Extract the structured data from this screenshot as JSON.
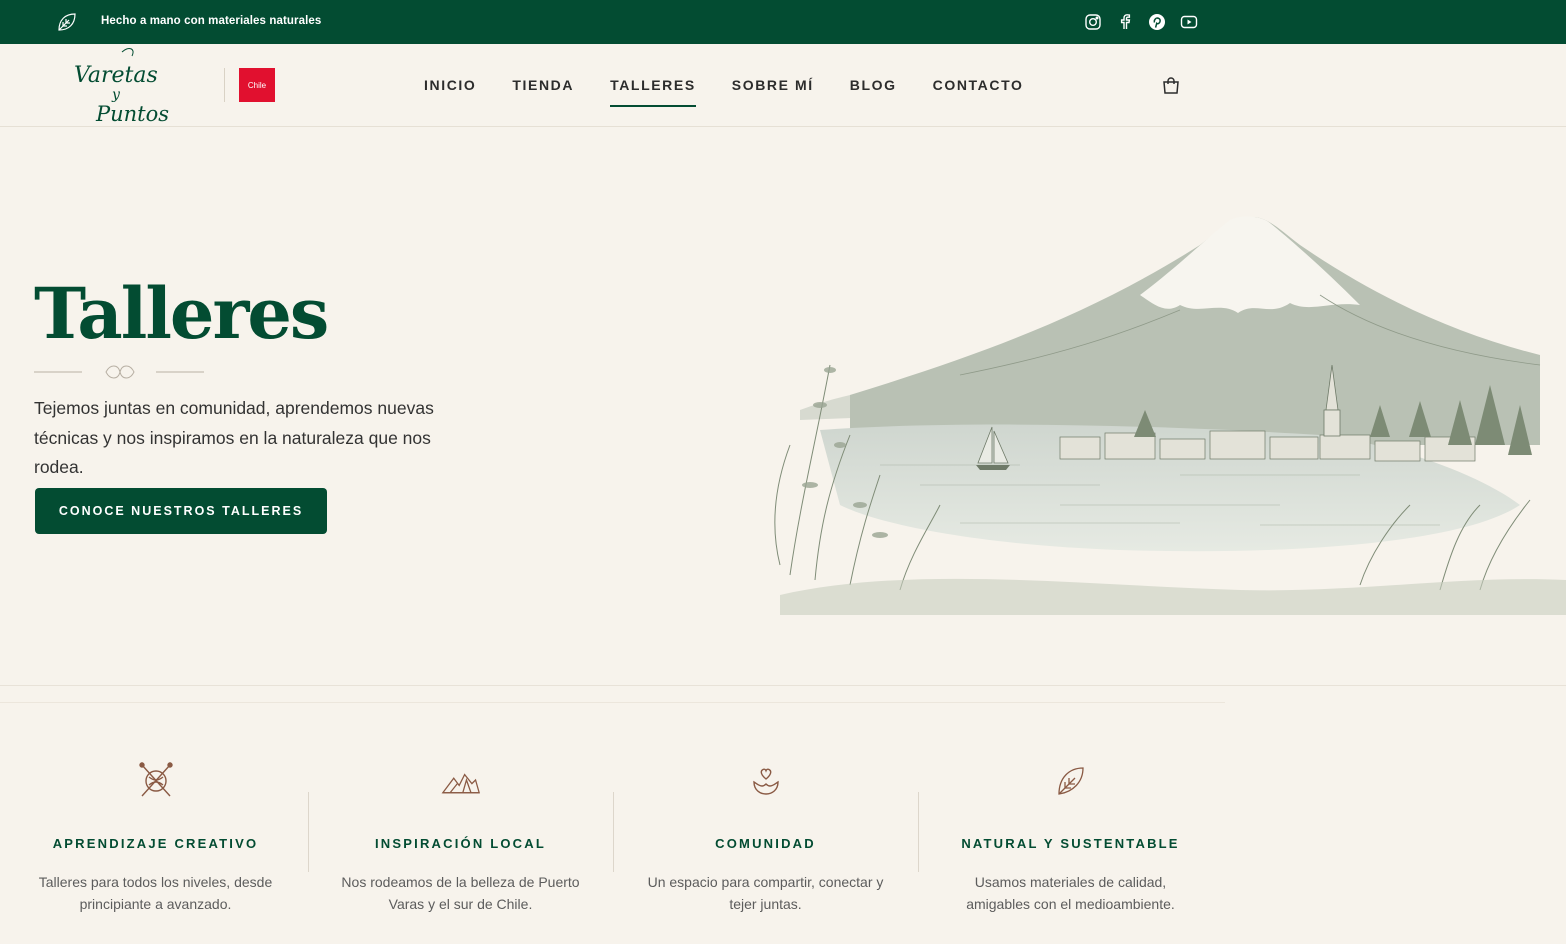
{
  "topbar": {
    "tagline": "Hecho a mano con materiales naturales",
    "social": [
      "instagram-icon",
      "facebook-icon",
      "pinterest-icon",
      "youtube-icon"
    ]
  },
  "header": {
    "logo_lines": [
      "Varetas",
      "y",
      "Puntos"
    ],
    "flag_label": "Chile",
    "nav": [
      {
        "label": "INICIO",
        "active": false
      },
      {
        "label": "TIENDA",
        "active": false
      },
      {
        "label": "TALLERES",
        "active": true
      },
      {
        "label": "SOBRE MÍ",
        "active": false
      },
      {
        "label": "BLOG",
        "active": false
      },
      {
        "label": "CONTACTO",
        "active": false
      }
    ]
  },
  "hero": {
    "title": "Talleres",
    "text": "Tejemos juntas en comunidad, aprendemos nuevas técnicas y nos inspiramos en la naturaleza que nos rodea.",
    "cta": "CONOCE NUESTROS TALLERES"
  },
  "features": [
    {
      "icon": "knitting-needles-icon",
      "title": "APRENDIZAJE CREATIVO",
      "desc": "Talleres para todos los niveles, desde principiante a avanzado."
    },
    {
      "icon": "mountains-icon",
      "title": "INSPIRACIÓN LOCAL",
      "desc": "Nos rodeamos de la belleza de Puerto Varas y el sur de Chile."
    },
    {
      "icon": "heart-hands-icon",
      "title": "COMUNIDAD",
      "desc": "Un espacio para compartir, conectar y tejer juntas."
    },
    {
      "icon": "leaf-icon",
      "title": "NATURAL Y SUSTENTABLE",
      "desc": "Usamos materiales de calidad, amigables con el medioambiente."
    }
  ],
  "colors": {
    "brand": "#034c32",
    "background": "#f7f3ec",
    "accent": "#8a5a44"
  }
}
